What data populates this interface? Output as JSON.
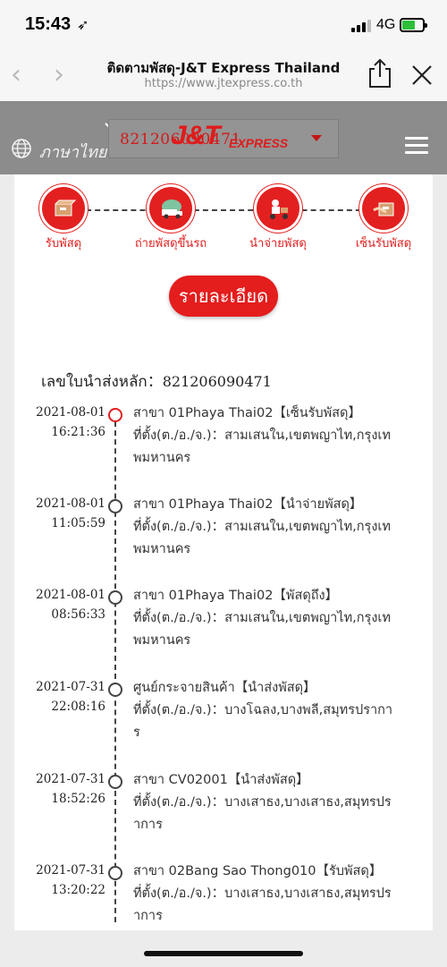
{
  "status_bar": {
    "time": "15:43",
    "location_arrow": "➶",
    "network": "4G"
  },
  "browser": {
    "page_title": "ติดตามพัสดุ-J&T Express Thailand",
    "url": "https://www.jtexpress.co.th",
    "back_icon": "‹",
    "forward_icon": "›"
  },
  "header": {
    "language": "ภาษาไทย",
    "tracking_select_value": "821206090471",
    "logo_main": "J&T",
    "logo_sub": "EXPRESS"
  },
  "steps": [
    {
      "label": "รับพัสดุ",
      "icon": "pickup-icon"
    },
    {
      "label": "ถ่ายพัสดุขึ้นรถ",
      "icon": "truck-icon"
    },
    {
      "label": "นำจ่ายพัสดุ",
      "icon": "delivery-icon"
    },
    {
      "label": "เซ็นรับพัสดุ",
      "icon": "signed-icon"
    }
  ],
  "detail_button": "รายละเอียด",
  "main_waybill": {
    "label": "เลขใบนำส่งหลัก：",
    "number": "821206090471"
  },
  "events": [
    {
      "date": "2021-08-01",
      "time": "16:21:36",
      "line1": "สาขา 01Phaya Thai02【เซ็นรับพัสดุ】",
      "line2": "ที่ตั้ง(ต./อ./จ.)：สามเสนใน,เขตพญาไท,กรุงเท",
      "line3": "พมหานคร",
      "active": true
    },
    {
      "date": "2021-08-01",
      "time": "11:05:59",
      "line1": "สาขา 01Phaya Thai02【นำจ่ายพัสดุ】",
      "line2": "ที่ตั้ง(ต./อ./จ.)：สามเสนใน,เขตพญาไท,กรุงเท",
      "line3": "พมหานคร",
      "active": false
    },
    {
      "date": "2021-08-01",
      "time": "08:56:33",
      "line1": "สาขา 01Phaya Thai02【พัสดุถึง】",
      "line2": "ที่ตั้ง(ต./อ./จ.)：สามเสนใน,เขตพญาไท,กรุงเท",
      "line3": "พมหานคร",
      "active": false
    },
    {
      "date": "2021-07-31",
      "time": "22:08:16",
      "line1": "ศูนย์กระจายสินค้า【นำส่งพัสดุ】",
      "line2": "ที่ตั้ง(ต./อ./จ.)：บางโฉลง,บางพลี,สมุทรปรากา",
      "line3": "ร",
      "active": false
    },
    {
      "date": "2021-07-31",
      "time": "18:52:26",
      "line1": "สาขา CV02001【นำส่งพัสดุ】",
      "line2": "ที่ตั้ง(ต./อ./จ.)：บางเสาธง,บางเสาธง,สมุทรปร",
      "line3": "าการ",
      "active": false
    },
    {
      "date": "2021-07-31",
      "time": "13:20:22",
      "line1": "สาขา 02Bang Sao Thong010【รับพัสดุ】",
      "line2": "ที่ตั้ง(ต./อ./จ.)：บางเสาธง,บางเสาธง,สมุทรปร",
      "line3": "าการ",
      "active": false
    }
  ],
  "colors": {
    "brand_red": "#e41d1d",
    "header_gray": "#8c8c8c"
  }
}
